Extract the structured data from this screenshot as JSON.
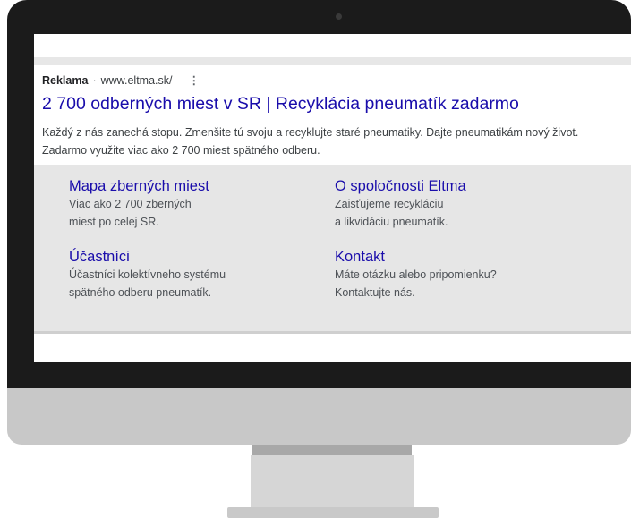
{
  "ad": {
    "label": "Reklama",
    "separator": "·",
    "url": "www.eltma.sk/",
    "menu_icon": "⋮",
    "title": "2 700 odberných miest v SR | Recyklácia pneumatík zadarmo",
    "description": "Každý z nás zanechá stopu. Zmenšite tú svoju a recyklujte staré pneumatiky. Dajte pneumatikám nový život. Zadarmo využite viac ako 2 700 miest spätného odberu."
  },
  "sitelinks": [
    {
      "title": "Mapa zberných miest",
      "line1": "Viac ako 2 700 zberných",
      "line2": "miest po celej SR."
    },
    {
      "title": "O spoločnosti Eltma",
      "line1": "Zaisťujeme recykláciu",
      "line2": "a likvidáciu pneumatík."
    },
    {
      "title": "Účastníci",
      "line1": "Účastníci kolektívneho systému",
      "line2": "spätného odberu pneumatík."
    },
    {
      "title": "Kontakt",
      "line1": "Máte otázku alebo pripomienku?",
      "line2": "Kontaktujte nás."
    }
  ],
  "colors": {
    "link": "#1a0dab",
    "bezel": "#1b1b1b",
    "sitelink_bg": "#e6e6e6"
  }
}
